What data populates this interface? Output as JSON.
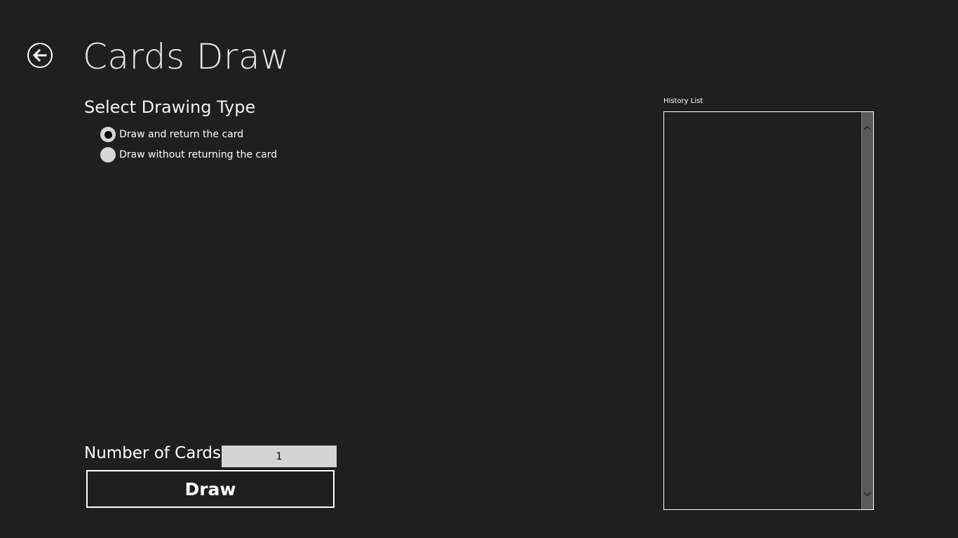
{
  "header": {
    "title": "Cards Draw",
    "back_icon": "arrow-left-icon"
  },
  "drawing_type": {
    "heading": "Select Drawing Type",
    "options": [
      {
        "label": "Draw and return the card",
        "selected": true
      },
      {
        "label": "Draw without returning the card",
        "selected": false
      }
    ]
  },
  "controls": {
    "number_label": "Number of Cards",
    "number_value": "1",
    "draw_label": "Draw"
  },
  "history": {
    "label": "History List",
    "items": []
  },
  "colors": {
    "background": "#1f1f1f",
    "text": "#ffffff",
    "input_background": "#d4d4d4",
    "radio_fill": "#d6d6d6"
  }
}
